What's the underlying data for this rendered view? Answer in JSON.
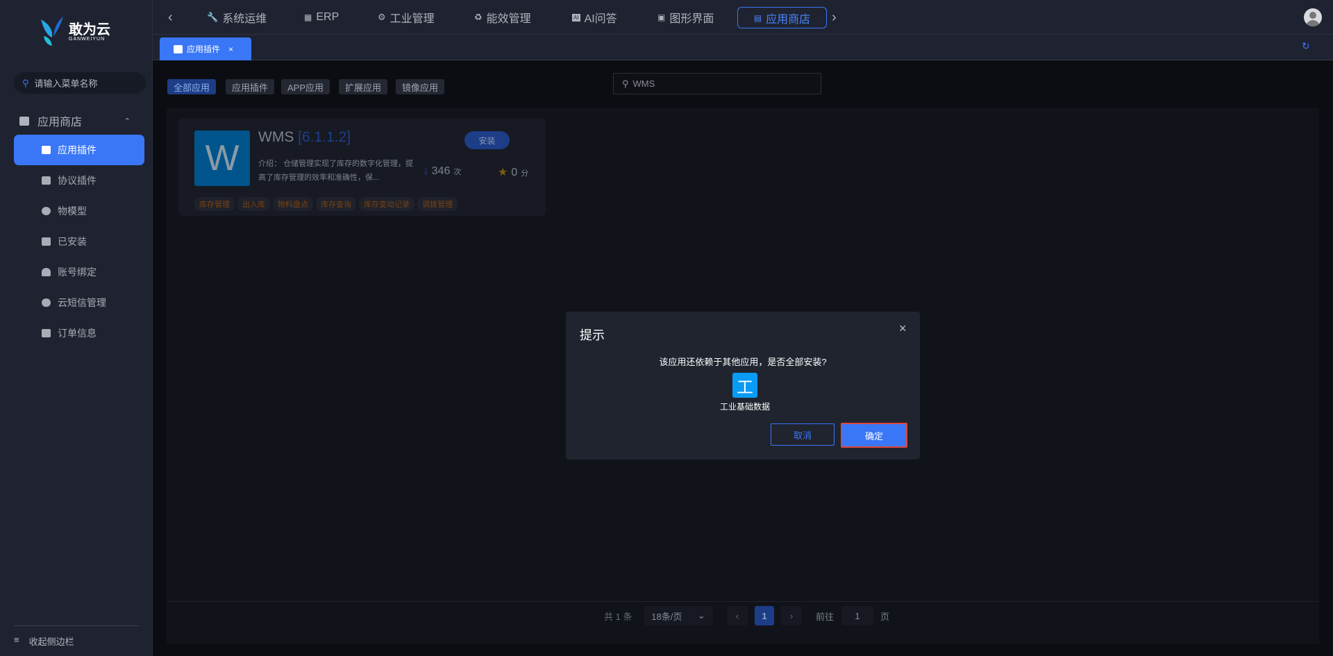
{
  "brand": {
    "name": "敢为云",
    "sub": "GANWEIYUN"
  },
  "sidebar": {
    "search_placeholder": "请输入菜单名称",
    "group": "应用商店",
    "items": [
      {
        "label": "应用插件",
        "icon": "home-icon",
        "active": true
      },
      {
        "label": "协议插件",
        "icon": "plugin-icon"
      },
      {
        "label": "物模型",
        "icon": "model-icon"
      },
      {
        "label": "已安装",
        "icon": "installed-icon"
      },
      {
        "label": "账号绑定",
        "icon": "user-icon"
      },
      {
        "label": "云短信管理",
        "icon": "cloud-icon"
      },
      {
        "label": "订单信息",
        "icon": "clipboard-icon"
      }
    ],
    "collapse": "收起侧边栏"
  },
  "topnav": {
    "items": [
      "系统运维",
      "ERP",
      "工业管理",
      "能效管理",
      "AI问答",
      "图形界面"
    ],
    "active": "应用商店"
  },
  "tabs": [
    {
      "label": "应用插件"
    }
  ],
  "filters": [
    "全部应用",
    "应用插件",
    "APP应用",
    "扩展应用",
    "镜像应用"
  ],
  "search": {
    "value": "WMS"
  },
  "card": {
    "letter": "W",
    "name": "WMS",
    "version": "[6.1.1.2]",
    "install": "安装",
    "intro_label": "介绍：",
    "intro": "仓储管理实现了库存的数字化管理，提高了库存管理的效率和准确性，保...",
    "downloads": "346",
    "downloads_unit": "次",
    "score": "0",
    "score_unit": "分",
    "tags": [
      "库存管理",
      "出入库",
      "物料盘点",
      "库存查询",
      "库存变动记录",
      "调拨管理"
    ]
  },
  "pagination": {
    "total": "共 1 条",
    "page_size": "18条/页",
    "current": "1",
    "goto": "前往",
    "goto_value": "1",
    "page_unit": "页"
  },
  "dialog": {
    "title": "提示",
    "message": "该应用还依赖于其他应用，是否全部安装?",
    "dep_letter": "工",
    "dep_name": "工业基础数据",
    "cancel": "取消",
    "confirm": "确定"
  },
  "colors": {
    "accent": "#3a77f7",
    "tag": "#7a4212",
    "highlight": "#e0463c"
  }
}
